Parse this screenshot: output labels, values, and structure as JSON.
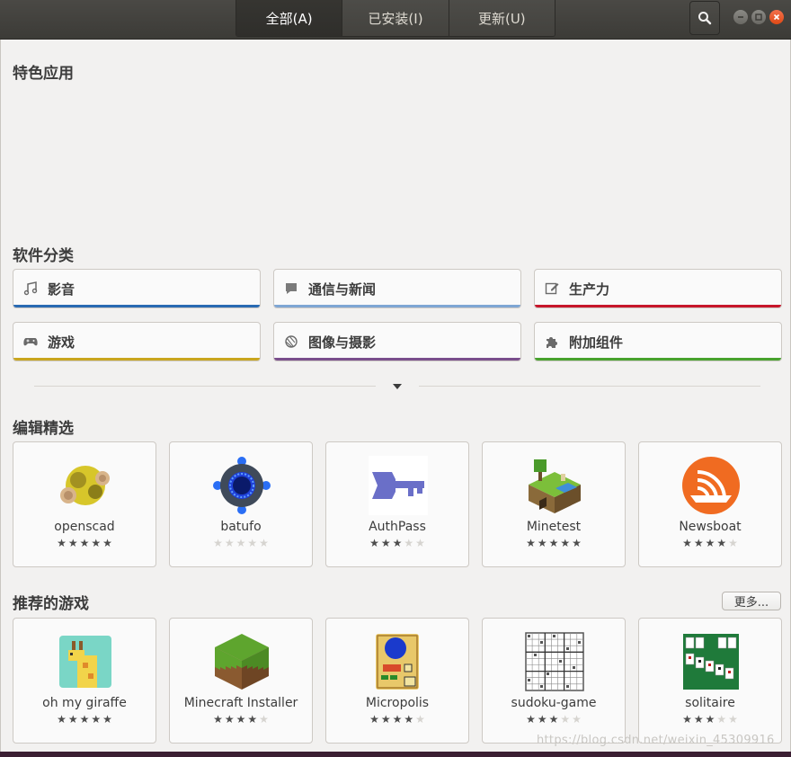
{
  "header": {
    "tabs": [
      {
        "label": "全部(A)",
        "active": true
      },
      {
        "label": "已安装(I)",
        "active": false
      },
      {
        "label": "更新(U)",
        "active": false
      }
    ],
    "search_icon": "search-icon",
    "window_controls": [
      "minimize-icon",
      "maximize-icon",
      "close-icon"
    ]
  },
  "featured": {
    "title": "特色应用"
  },
  "categories": {
    "title": "软件分类",
    "items": [
      {
        "label": "影音",
        "icon": "music-icon",
        "color": "#2a6bb3"
      },
      {
        "label": "通信与新闻",
        "icon": "chat-icon",
        "color": "#7fa6d4"
      },
      {
        "label": "生产力",
        "icon": "edit-icon",
        "color": "#c7162b"
      },
      {
        "label": "游戏",
        "icon": "gamepad-icon",
        "color": "#c9a61f"
      },
      {
        "label": "图像与摄影",
        "icon": "camera-icon",
        "color": "#7a4e8c"
      },
      {
        "label": "附加组件",
        "icon": "puzzle-icon",
        "color": "#48a22e"
      }
    ]
  },
  "editors_picks": {
    "title": "编辑精选",
    "apps": [
      {
        "name": "openscad",
        "rating": 5
      },
      {
        "name": "batufo",
        "rating": 0
      },
      {
        "name": "AuthPass",
        "rating": 3
      },
      {
        "name": "Minetest",
        "rating": 5
      },
      {
        "name": "Newsboat",
        "rating": 4
      }
    ]
  },
  "recommended_games": {
    "title": "推荐的游戏",
    "more_label": "更多...",
    "apps": [
      {
        "name": "oh my giraffe",
        "rating": 5
      },
      {
        "name": "Minecraft Installer",
        "rating": 4
      },
      {
        "name": "Micropolis",
        "rating": 4
      },
      {
        "name": "sudoku-game",
        "rating": 3
      },
      {
        "name": "solitaire",
        "rating": 3
      }
    ]
  },
  "watermark": "https://blog.csdn.net/weixin_45309916",
  "colors": {
    "accent_close": "#e95420",
    "background": "#f2f1f0",
    "headerbar": "#3c3b37"
  }
}
